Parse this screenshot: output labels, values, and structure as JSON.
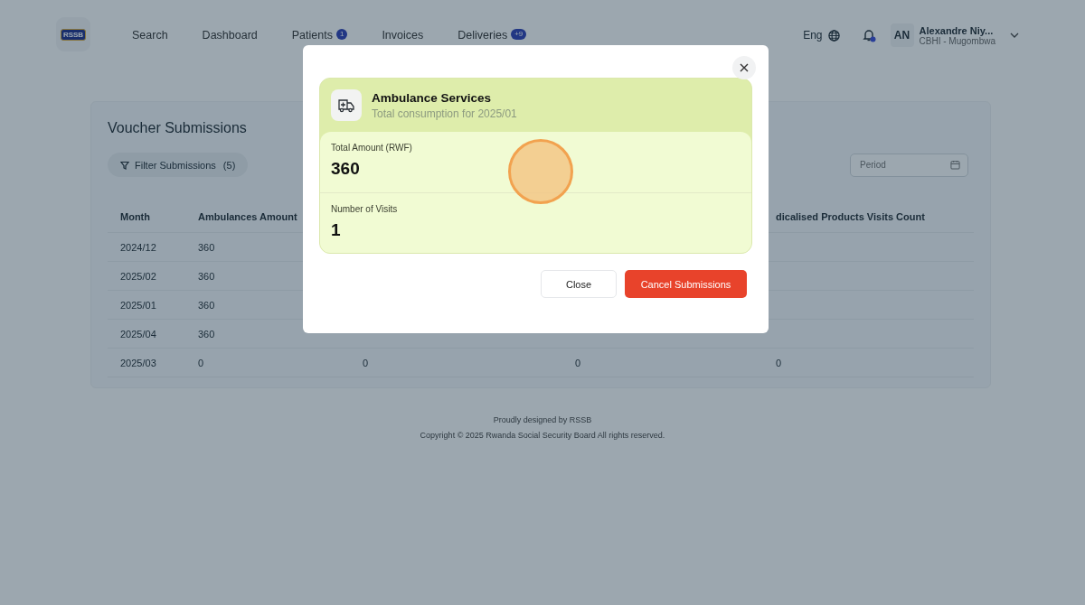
{
  "logo": {
    "text": "RSSB"
  },
  "nav": [
    {
      "label": "Search"
    },
    {
      "label": "Dashboard"
    },
    {
      "label": "Patients",
      "badge": "1"
    },
    {
      "label": "Invoices"
    },
    {
      "label": "Deliveries",
      "badge": "+9"
    }
  ],
  "user_bar": {
    "language": "Eng",
    "notification": true,
    "initials": "AN",
    "name": "Alexandre Niy...",
    "org": "CBHI - Mugombwa"
  },
  "card": {
    "title": "Voucher Submissions",
    "filter": {
      "label": "Filter Submissions",
      "count": "(5)"
    },
    "period": {
      "placeholder": "Period"
    }
  },
  "table": {
    "columns": [
      "Month",
      "Ambulances Amount",
      null,
      null,
      "dicalised Products Visits Count"
    ],
    "rows": [
      [
        "2024/12",
        "360",
        null,
        null,
        null
      ],
      [
        "2025/02",
        "360",
        null,
        null,
        null
      ],
      [
        "2025/01",
        "360",
        null,
        null,
        null
      ],
      [
        "2025/04",
        "360",
        null,
        null,
        null
      ],
      [
        "2025/03",
        "0",
        "0",
        "0",
        "0"
      ]
    ]
  },
  "footer": {
    "line_1": "Proudly designed by RSSB",
    "line_2": "Copyright © 2025 Rwanda Social Security Board All rights reserved."
  },
  "modal": {
    "title": "Ambulance Services",
    "subtitle": "Total consumption for 2025/01",
    "stats": [
      {
        "label": "Total Amount (RWF)",
        "value": "360"
      },
      {
        "label": "Number of Visits",
        "value": "1"
      }
    ],
    "buttons": [
      {
        "label": "Close",
        "kind": "secondary"
      },
      {
        "label": "Cancel Submissions",
        "kind": "danger"
      }
    ]
  }
}
